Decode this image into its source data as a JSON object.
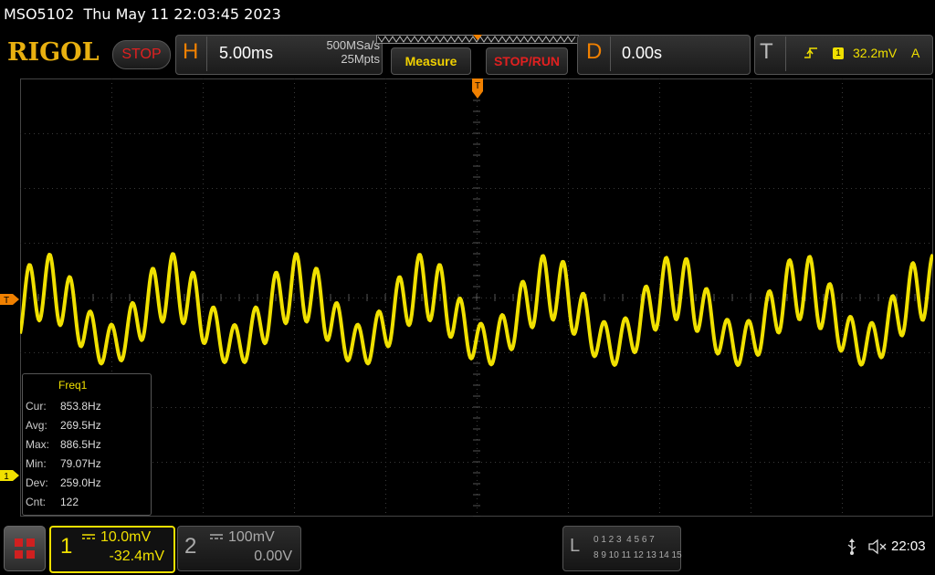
{
  "title_bar": {
    "text": "MSO5102  Thu May 11 22:03:45 2023"
  },
  "header": {
    "logo": "RIGOL",
    "run_state": "STOP",
    "horizontal": {
      "letter": "H",
      "timebase": "5.00ms",
      "sample_rate": "500MSa/s",
      "memory_depth": "25Mpts"
    },
    "measure_label": "Measure",
    "stop_run_label": "STOP/RUN",
    "delay": {
      "letter": "D",
      "value": "0.00s"
    },
    "trigger": {
      "letter": "T",
      "source": "1",
      "level": "32.2mV",
      "mode": "A"
    }
  },
  "markers": {
    "trigger_position": "T",
    "trigger_level": "T",
    "channel1": "1"
  },
  "measurement": {
    "title": "Freq1",
    "rows": [
      {
        "label": "Cur:",
        "value": "853.8Hz"
      },
      {
        "label": "Avg:",
        "value": "269.5Hz"
      },
      {
        "label": "Max:",
        "value": "886.5Hz"
      },
      {
        "label": "Min:",
        "value": "79.07Hz"
      },
      {
        "label": "Dev:",
        "value": "259.0Hz"
      },
      {
        "label": "Cnt:",
        "value": "122"
      }
    ]
  },
  "channels": [
    {
      "number": "1",
      "scale": "10.0mV",
      "offset": "-32.4mV",
      "color": "#f0e000",
      "active": true
    },
    {
      "number": "2",
      "scale": "100mV",
      "offset": "0.00V",
      "color": "#aaaaaa",
      "active": false
    }
  ],
  "logic_analyzer": {
    "letter": "L",
    "row1": "0 1 2 3  4 5 6 7",
    "row2": "8 9 10 11 12 13 14 15"
  },
  "status": {
    "clock": "22:03",
    "usb_icon": "usb-icon",
    "speaker_icon": "speaker-muted-icon"
  },
  "colors": {
    "accent": "#f08000",
    "trace": "#f0e000",
    "stop": "#e02020"
  }
}
